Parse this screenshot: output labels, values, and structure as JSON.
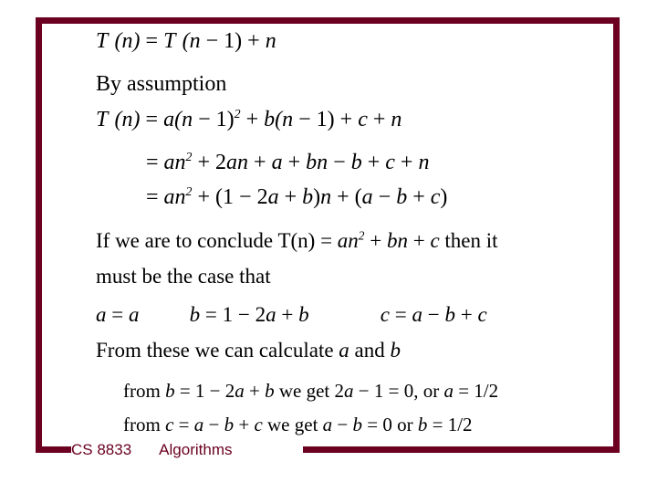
{
  "slide": {
    "background_color": "#ffffff",
    "accent_color": "#6B0020",
    "text_color": "#000000"
  },
  "content": {
    "lines": [
      {
        "id": "line1",
        "text": "T (n) = T (n − 1) + n"
      },
      {
        "id": "line2",
        "text": "By assumption"
      },
      {
        "id": "line3",
        "text": "T (n) = a(n − 1)² + b(n − 1) + c + n"
      },
      {
        "id": "line4",
        "text": "= an² + 2an + a + bn − b + c + n"
      },
      {
        "id": "line5",
        "text": "= an² + (1 − 2a + b)n + (a − b + c)"
      },
      {
        "id": "line6",
        "text": "If we are to conclude T(n) = an² + bn + c then it"
      },
      {
        "id": "line7",
        "text": "must be the case that"
      },
      {
        "id": "line8",
        "text": "a = a     b = 1 − 2a + b        c = a − b + c"
      },
      {
        "id": "line9",
        "text": "From these we can calculate a and b"
      },
      {
        "id": "line10",
        "text": "from b = 1 − 2a + b we get 2a − 1 = 0, or a = 1/2"
      },
      {
        "id": "line11",
        "text": "from c = a − b + c we get a − b = 0 or b = 1/2"
      }
    ]
  },
  "footer": {
    "course": "CS 8833",
    "subject": "Algorithms"
  }
}
